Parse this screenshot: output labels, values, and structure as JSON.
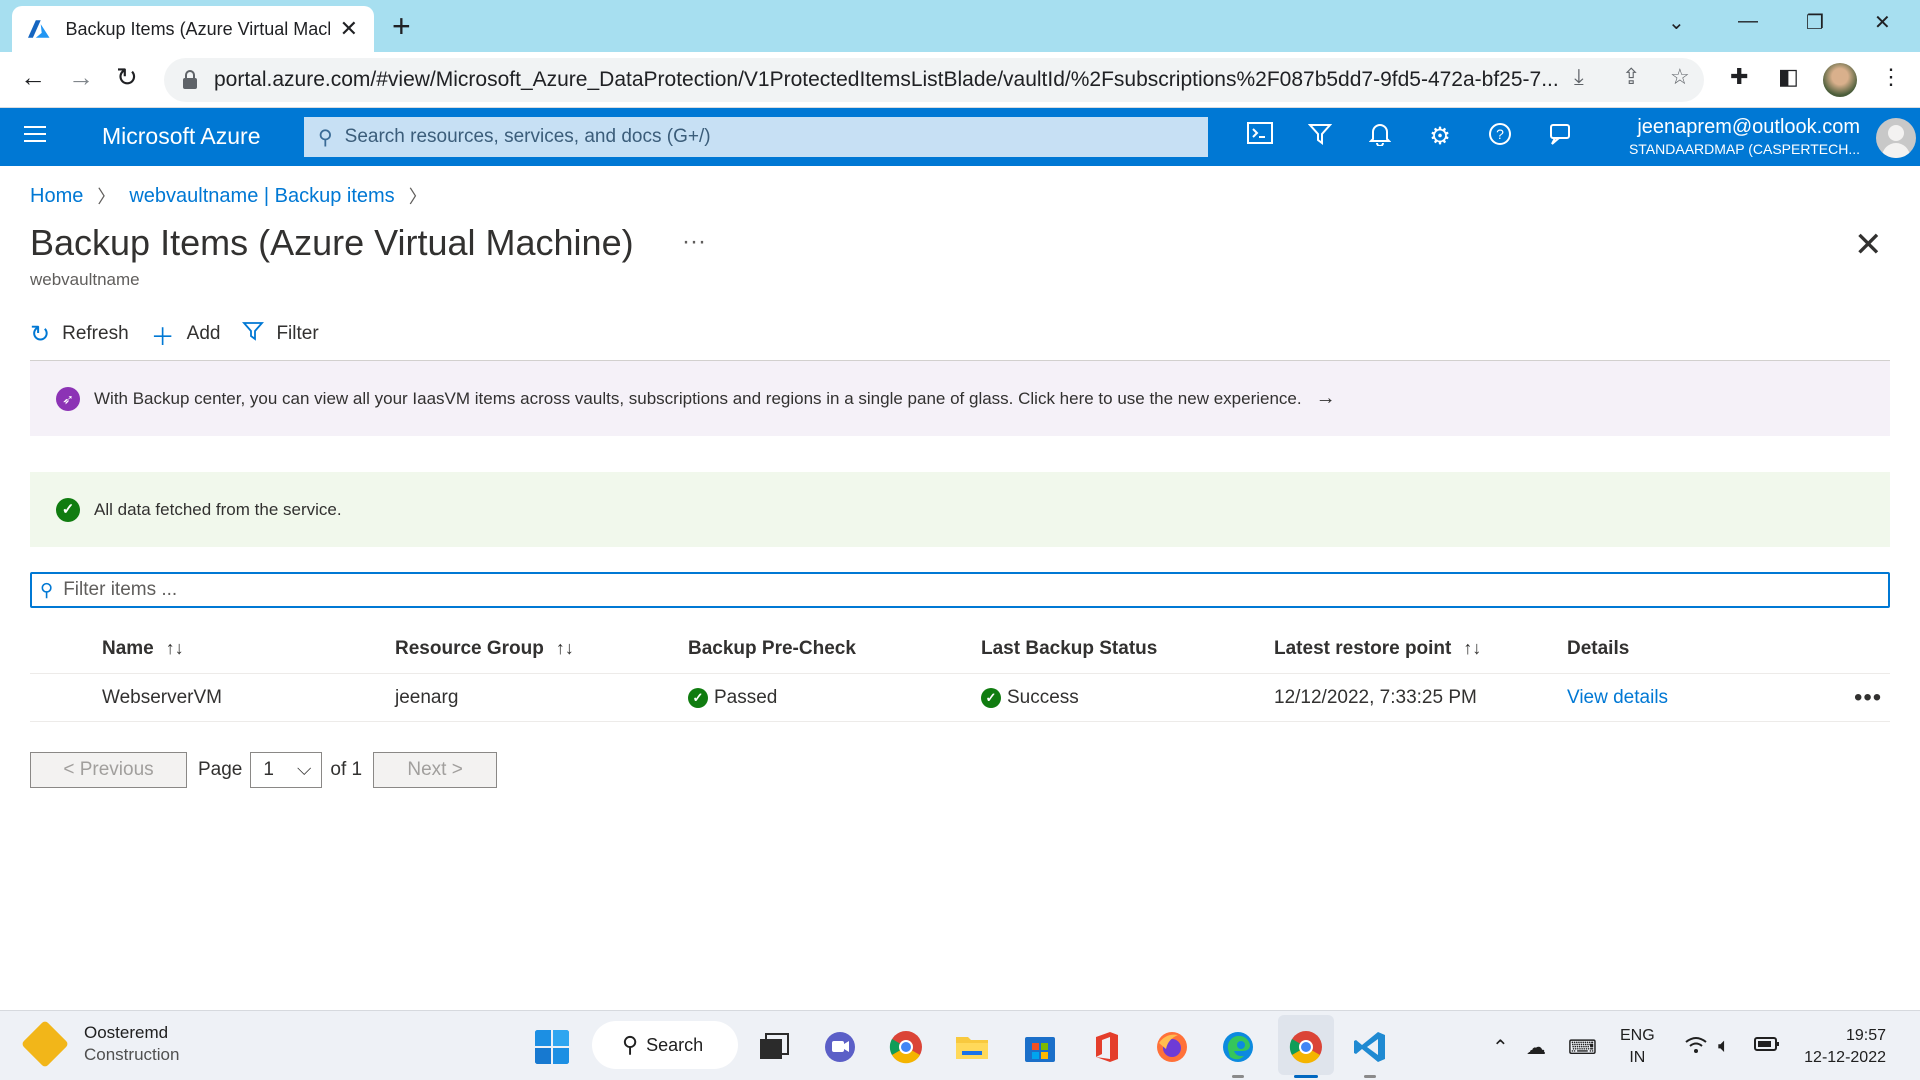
{
  "browser": {
    "tab_title": "Backup Items (Azure Virtual Machine)",
    "url": "portal.azure.com/#view/Microsoft_Azure_DataProtection/V1ProtectedItemsListBlade/vaultId/%2Fsubscriptions%2F087b5dd7-9fd5-472a-bf25-7..."
  },
  "azure": {
    "brand": "Microsoft Azure",
    "search_placeholder": "Search resources, services, and docs (G+/)",
    "account_email": "jeenaprem@outlook.com",
    "account_tenant": "STANDAARDMAP (CASPERTECH..."
  },
  "breadcrumb": [
    "Home",
    "webvaultname | Backup items"
  ],
  "page": {
    "title": "Backup Items (Azure Virtual Machine)",
    "subtitle": "webvaultname",
    "more": "···"
  },
  "commands": {
    "refresh": "Refresh",
    "add": "Add",
    "filter": "Filter"
  },
  "banner": "With Backup center, you can view all your IaasVM items across vaults, subscriptions and regions in a single pane of glass. Click here to use the new experience.",
  "status_message": "All data fetched from the service.",
  "filter_placeholder": "Filter items ...",
  "table": {
    "headers": [
      "Name",
      "Resource Group",
      "Backup Pre-Check",
      "Last Backup Status",
      "Latest restore point",
      "Details"
    ],
    "rows": [
      {
        "name": "WebserverVM",
        "resource_group": "jeenarg",
        "pre_check": "Passed",
        "last_backup": "Success",
        "restore_point": "12/12/2022, 7:33:25 PM",
        "details": "View details"
      }
    ]
  },
  "pager": {
    "previous": "< Previous",
    "page_label": "Page",
    "page_value": "1",
    "of_label": "of 1",
    "next": "Next >"
  },
  "taskbar": {
    "weather_line1": "Oosteremd",
    "weather_line2": "Construction",
    "search": "Search",
    "lang1": "ENG",
    "lang2": "IN",
    "time": "19:57",
    "date": "12-12-2022"
  },
  "colors": {
    "azure_blue": "#0078d4",
    "success_green": "#107c10",
    "tab_strip": "#a7dff0"
  }
}
